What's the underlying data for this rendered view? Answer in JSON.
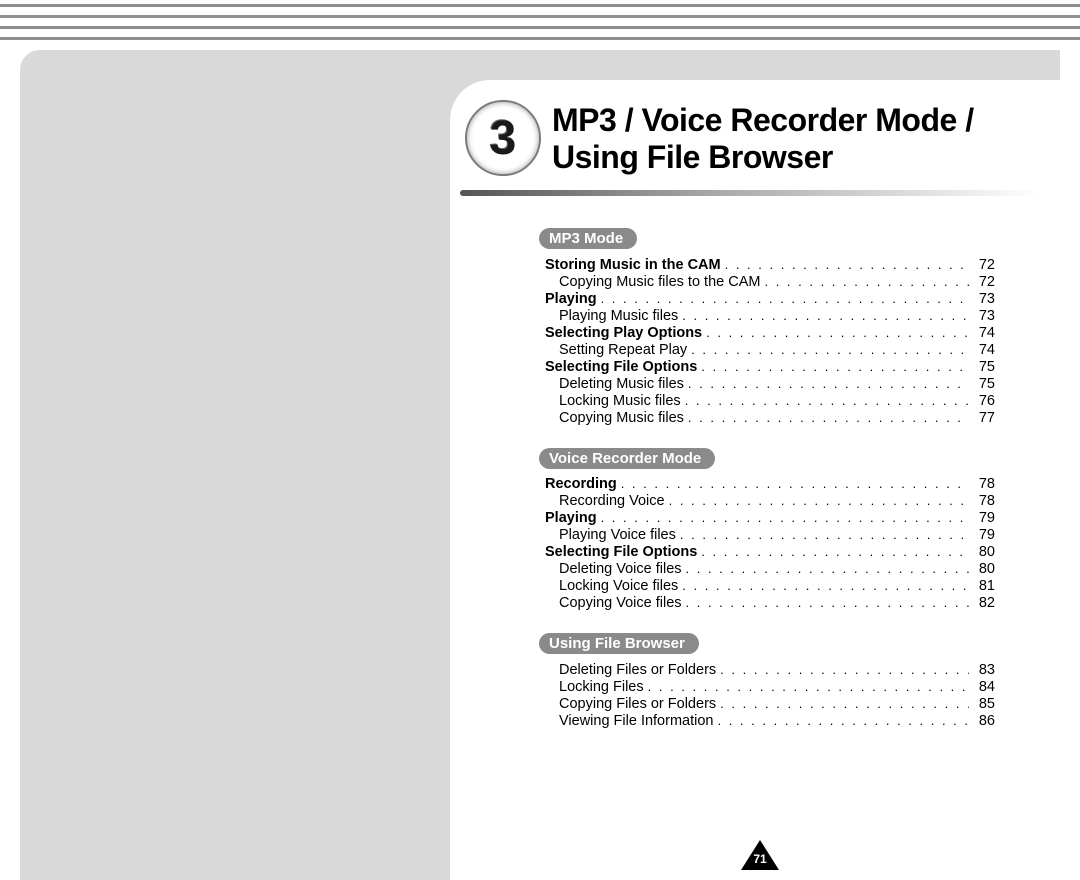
{
  "chapter": {
    "number": "3",
    "title_line1": "MP3 / Voice Recorder Mode /",
    "title_line2": "Using File Browser"
  },
  "page_number": "71",
  "sections": [
    {
      "heading": "MP3 Mode",
      "entries": [
        {
          "label": "Storing Music in the CAM",
          "page": "72",
          "bold": true
        },
        {
          "label": "Copying Music files to the CAM",
          "page": "72",
          "sub": true
        },
        {
          "label": "Playing",
          "page": "73",
          "bold": true
        },
        {
          "label": "Playing Music files",
          "page": "73",
          "sub": true
        },
        {
          "label": "Selecting Play Options",
          "page": "74",
          "bold": true
        },
        {
          "label": "Setting Repeat Play",
          "page": "74",
          "sub": true
        },
        {
          "label": "Selecting File Options",
          "page": "75",
          "bold": true
        },
        {
          "label": "Deleting Music files",
          "page": "75",
          "sub": true
        },
        {
          "label": "Locking Music files",
          "page": "76",
          "sub": true
        },
        {
          "label": "Copying Music files",
          "page": "77",
          "sub": true
        }
      ]
    },
    {
      "heading": "Voice Recorder Mode",
      "entries": [
        {
          "label": "Recording",
          "page": "78",
          "bold": true
        },
        {
          "label": "Recording Voice",
          "page": "78",
          "sub": true
        },
        {
          "label": "Playing",
          "page": "79",
          "bold": true
        },
        {
          "label": "Playing Voice files",
          "page": "79",
          "sub": true
        },
        {
          "label": "Selecting File Options",
          "page": "80",
          "bold": true
        },
        {
          "label": "Deleting Voice files",
          "page": "80",
          "sub": true
        },
        {
          "label": "Locking Voice files",
          "page": "81",
          "sub": true
        },
        {
          "label": "Copying Voice files",
          "page": "82",
          "sub": true
        }
      ]
    },
    {
      "heading": "Using File Browser",
      "entries": [
        {
          "label": "Deleting Files or Folders",
          "page": "83",
          "sub": true
        },
        {
          "label": "Locking Files",
          "page": "84",
          "sub": true
        },
        {
          "label": "Copying Files or Folders",
          "page": "85",
          "sub": true
        },
        {
          "label": "Viewing File Information",
          "page": "86",
          "sub": true
        }
      ]
    }
  ]
}
